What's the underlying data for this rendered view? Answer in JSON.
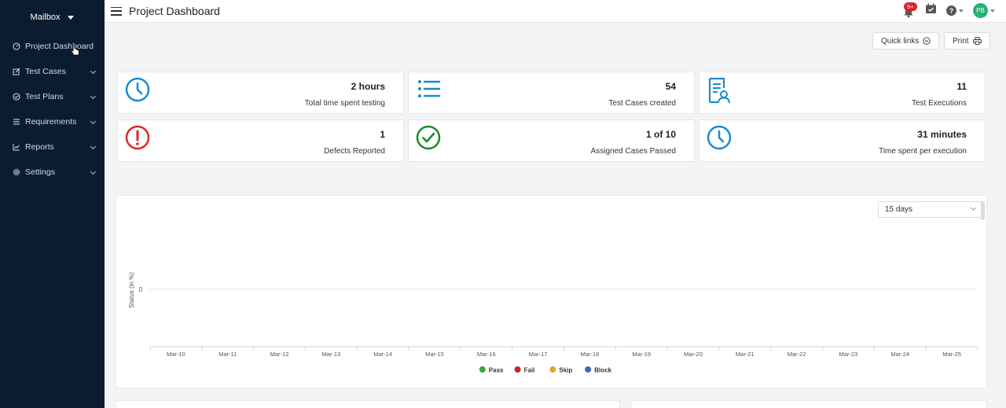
{
  "sidebar": {
    "workspace": "Mailbox",
    "items": [
      {
        "label": "Project Dashboard",
        "icon": "dashboard-icon",
        "has_submenu": false
      },
      {
        "label": "Test Cases",
        "icon": "edit-icon",
        "has_submenu": true
      },
      {
        "label": "Test Plans",
        "icon": "check-circle-icon",
        "has_submenu": true
      },
      {
        "label": "Requirements",
        "icon": "list-icon",
        "has_submenu": true
      },
      {
        "label": "Reports",
        "icon": "line-chart-icon",
        "has_submenu": true
      },
      {
        "label": "Settings",
        "icon": "gear-icon",
        "has_submenu": true
      }
    ]
  },
  "header": {
    "title": "Project Dashboard",
    "notification_badge": "9+",
    "avatar_initials": "PB"
  },
  "toolbar": {
    "quick_links": "Quick links",
    "print": "Print"
  },
  "stats": [
    {
      "value": "2 hours",
      "label": "Total time spent testing",
      "icon": "clock-icon",
      "color": "#1a8ccc"
    },
    {
      "value": "54",
      "label": "Test Cases created",
      "icon": "list-icon",
      "color": "#1a8ccc"
    },
    {
      "value": "11",
      "label": "Test Executions",
      "icon": "report-user-icon",
      "color": "#1a8ccc"
    },
    {
      "value": "1",
      "label": "Defects Reported",
      "icon": "alert-icon",
      "color": "#e02424"
    },
    {
      "value": "1 of 10",
      "label": "Assigned Cases Passed",
      "icon": "check-circle-icon",
      "color": "#198a2f"
    },
    {
      "value": "31 minutes",
      "label": "Time spent per execution",
      "icon": "clock-icon",
      "color": "#1a8ccc"
    }
  ],
  "range_select": "15 days",
  "chart_data": {
    "type": "line",
    "ylabel": "Status (in %)",
    "xlabel": "",
    "y_ticks": [
      "0"
    ],
    "categories": [
      "Mar-10",
      "Mar-11",
      "Mar-12",
      "Mar-13",
      "Mar-14",
      "Mar-15",
      "Mar-16",
      "Mar-17",
      "Mar-18",
      "Mar-19",
      "Mar-20",
      "Mar-21",
      "Mar-22",
      "Mar-23",
      "Mar-24",
      "Mar-25"
    ],
    "series": [
      {
        "name": "Pass",
        "color": "#3da33d",
        "values": []
      },
      {
        "name": "Fail",
        "color": "#c62828",
        "values": []
      },
      {
        "name": "Skip",
        "color": "#e0a82e",
        "values": []
      },
      {
        "name": "Block",
        "color": "#3d6fa8",
        "values": []
      }
    ],
    "legend": "bottom-center"
  }
}
